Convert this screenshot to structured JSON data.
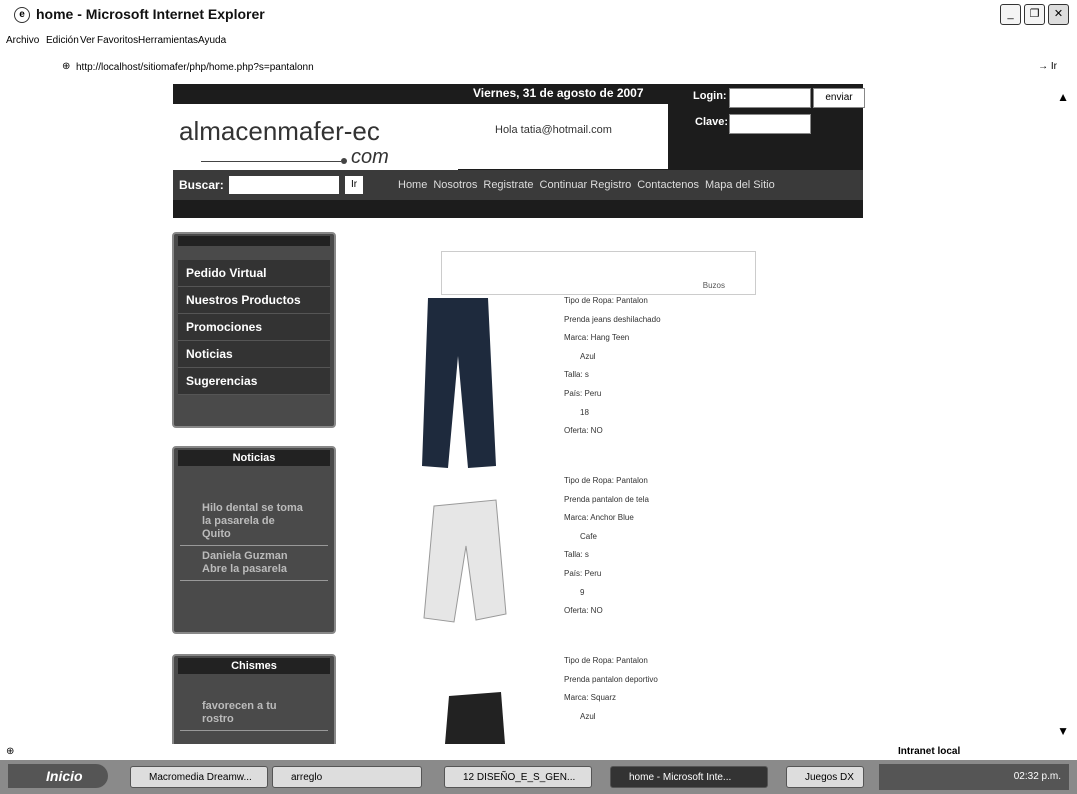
{
  "window": {
    "title": "home - Microsoft Internet Explorer"
  },
  "menubar": [
    "Archivo",
    "Edición",
    "Ver",
    "Favoritos",
    "Herramientas",
    "Ayuda"
  ],
  "address": {
    "url": "http://localhost/sitiomafer/php/home.php?s=pantalonn",
    "go_label": "Ir"
  },
  "site": {
    "date": "Viernes, 31 de agosto de 2007",
    "logo": "almacenmafer-ec",
    "logo_com": "com",
    "greeting": "Hola tatia@hotmail.com",
    "login_label": "Login:",
    "clave_label": "Clave:",
    "send_label": "enviar",
    "search_label": "Buscar:",
    "search_button": "Ir",
    "nav": [
      "Home",
      "Nosotros",
      "Registrate",
      "Continuar Registro",
      "Contactenos",
      "Mapa del Sitio"
    ]
  },
  "sidebar": {
    "menu": [
      "Pedido Virtual",
      "Nuestros Productos",
      "Promociones",
      "Noticias",
      "Sugerencias"
    ],
    "noticias_title": "Noticias",
    "noticias": [
      "Hilo dental se toma la pasarela de Quito",
      "Daniela Guzman Abre la pasarela"
    ],
    "chismes_title": "Chismes",
    "chismes": [
      "favorecen a tu rostro"
    ]
  },
  "category_label": "Buzos",
  "products": [
    {
      "tipo": "Tipo de Ropa: Pantalon",
      "prenda": "Prenda jeans deshilachado",
      "marca": "Marca: Hang Teen",
      "color": "Azul",
      "talla": "Talla: s",
      "pais": "País: Peru",
      "cantidad": "18",
      "oferta": "Oferta: NO"
    },
    {
      "tipo": "Tipo de Ropa: Pantalon",
      "prenda": "Prenda pantalon de tela",
      "marca": "Marca: Anchor Blue",
      "color": "Cafe",
      "talla": "Talla: s",
      "pais": "País: Peru",
      "cantidad": "9",
      "oferta": "Oferta: NO"
    },
    {
      "tipo": "Tipo de Ropa: Pantalon",
      "prenda": "Prenda pantalon deportivo",
      "marca": "Marca: Squarz",
      "color": "Azul"
    }
  ],
  "status": {
    "zone": "Intranet local"
  },
  "taskbar": {
    "start": "Inicio",
    "items": [
      "Macromedia Dreamw...",
      "arreglo",
      "12 DISEÑO_E_S_GEN...",
      "home - Microsoft Inte...",
      "Juegos DX"
    ],
    "clock": "02:32 p.m."
  }
}
